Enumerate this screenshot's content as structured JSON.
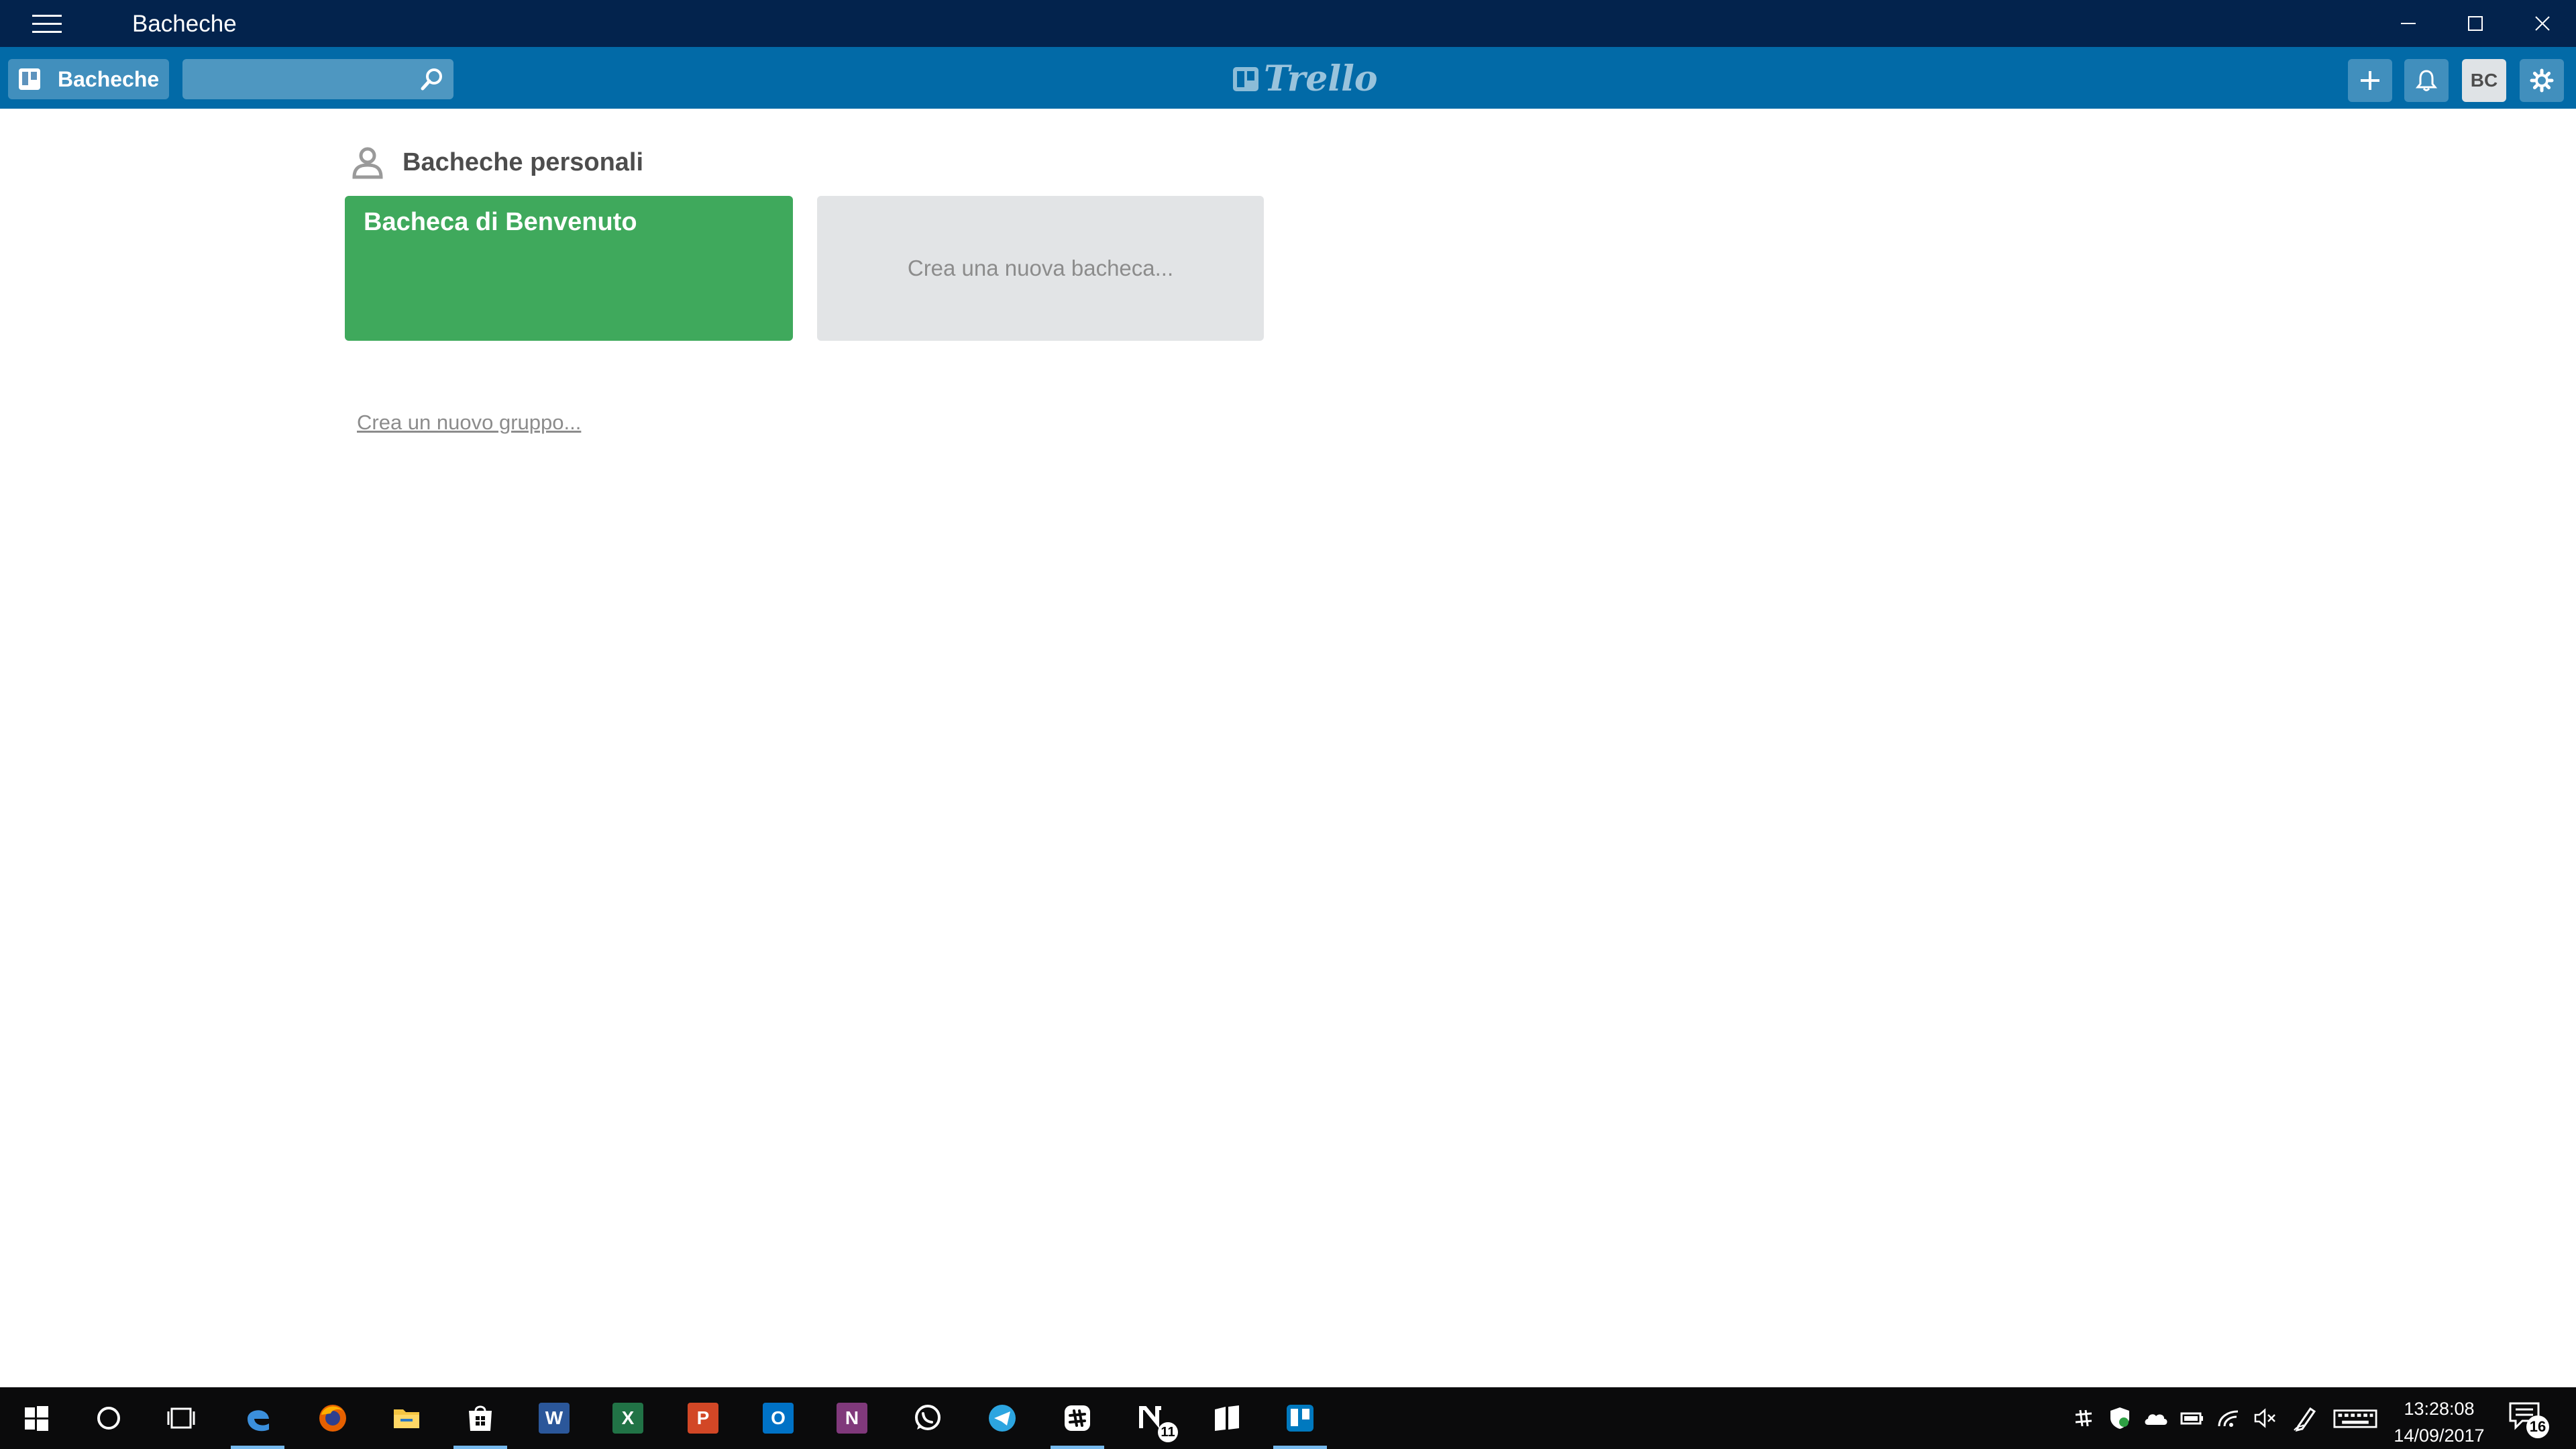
{
  "window": {
    "title": "Bacheche",
    "controls": [
      "minimize-icon",
      "maximize-icon",
      "close-icon"
    ]
  },
  "header": {
    "boards_button_label": "Bacheche",
    "search_value": "",
    "logo_text": "Trello",
    "avatar_initials": "BC",
    "accent_color": "#026aa7"
  },
  "content": {
    "section_title": "Bacheche personali",
    "boards": [
      {
        "name": "Bacheca di Benvenuto",
        "color": "#3fa95c"
      }
    ],
    "new_board_label": "Crea una nuova bacheca...",
    "new_group_label": "Crea un nuovo gruppo..."
  },
  "taskbar": {
    "apps": [
      {
        "name": "edge",
        "active": true
      },
      {
        "name": "firefox",
        "active": false
      },
      {
        "name": "file-explorer",
        "active": false
      },
      {
        "name": "store",
        "active": true
      },
      {
        "name": "word",
        "active": false
      },
      {
        "name": "excel",
        "active": false
      },
      {
        "name": "powerpoint",
        "active": false
      },
      {
        "name": "outlook",
        "active": false
      },
      {
        "name": "onenote",
        "active": false
      },
      {
        "name": "whatsapp",
        "active": false
      },
      {
        "name": "telegram",
        "active": false
      },
      {
        "name": "slack",
        "active": true
      },
      {
        "name": "app-n",
        "active": false
      },
      {
        "name": "app-flag",
        "active": false
      },
      {
        "name": "trello",
        "active": true
      }
    ],
    "app_badge": "11",
    "clock_time": "13:28:08",
    "clock_date": "14/09/2017",
    "notification_count": "16"
  }
}
